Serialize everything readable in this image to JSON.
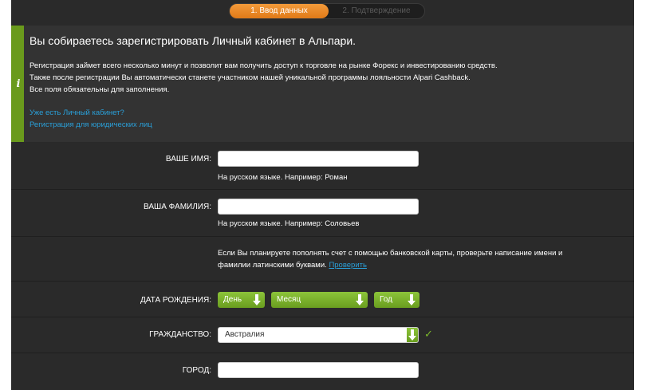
{
  "steps": {
    "active": "1. Ввод данных",
    "inactive": "2. Подтверждение"
  },
  "info": {
    "icon": "info-icon",
    "title": "Вы собираетесь зарегистрировать Личный кабинет в Альпари.",
    "lines": [
      "Регистрация займет всего несколько минут и позволит вам получить доступ к торговле на рынке Форекс и инвестированию средств.",
      "Также после регистрации Вы автоматически станете участником нашей уникальной программы лояльности Alpari Cashback.",
      "Все поля обязательны для заполнения."
    ],
    "links": [
      "Уже есть Личный кабинет?",
      "Регистрация для юридических лиц"
    ]
  },
  "form": {
    "first_name": {
      "label": "ВАШЕ ИМЯ:",
      "value": "",
      "hint": "На русском языке. Например: Роман"
    },
    "last_name": {
      "label": "ВАША ФАМИЛИЯ:",
      "value": "",
      "hint": "На русском языке. Например: Соловьев"
    },
    "card_note": {
      "line1": "Если Вы планируете пополнять счет с помощью банковской карты, проверьте написание имени и",
      "line2": "фамилии латинскими буквами.",
      "link": "Проверить"
    },
    "birth_date": {
      "label": "ДАТА РОЖДЕНИЯ:",
      "day": "День",
      "month": "Месяц",
      "year": "Год"
    },
    "citizenship": {
      "label": "ГРАЖДАНСТВО:",
      "value": "Австралия",
      "valid_icon": "checkmark-icon"
    },
    "city": {
      "label": "ГОРОД:",
      "value": ""
    }
  },
  "colors": {
    "accent_orange": "#e88a2a",
    "accent_green": "#7cb82a",
    "link_blue": "#2a9fd8",
    "panel_bg": "#2a2a2a"
  }
}
